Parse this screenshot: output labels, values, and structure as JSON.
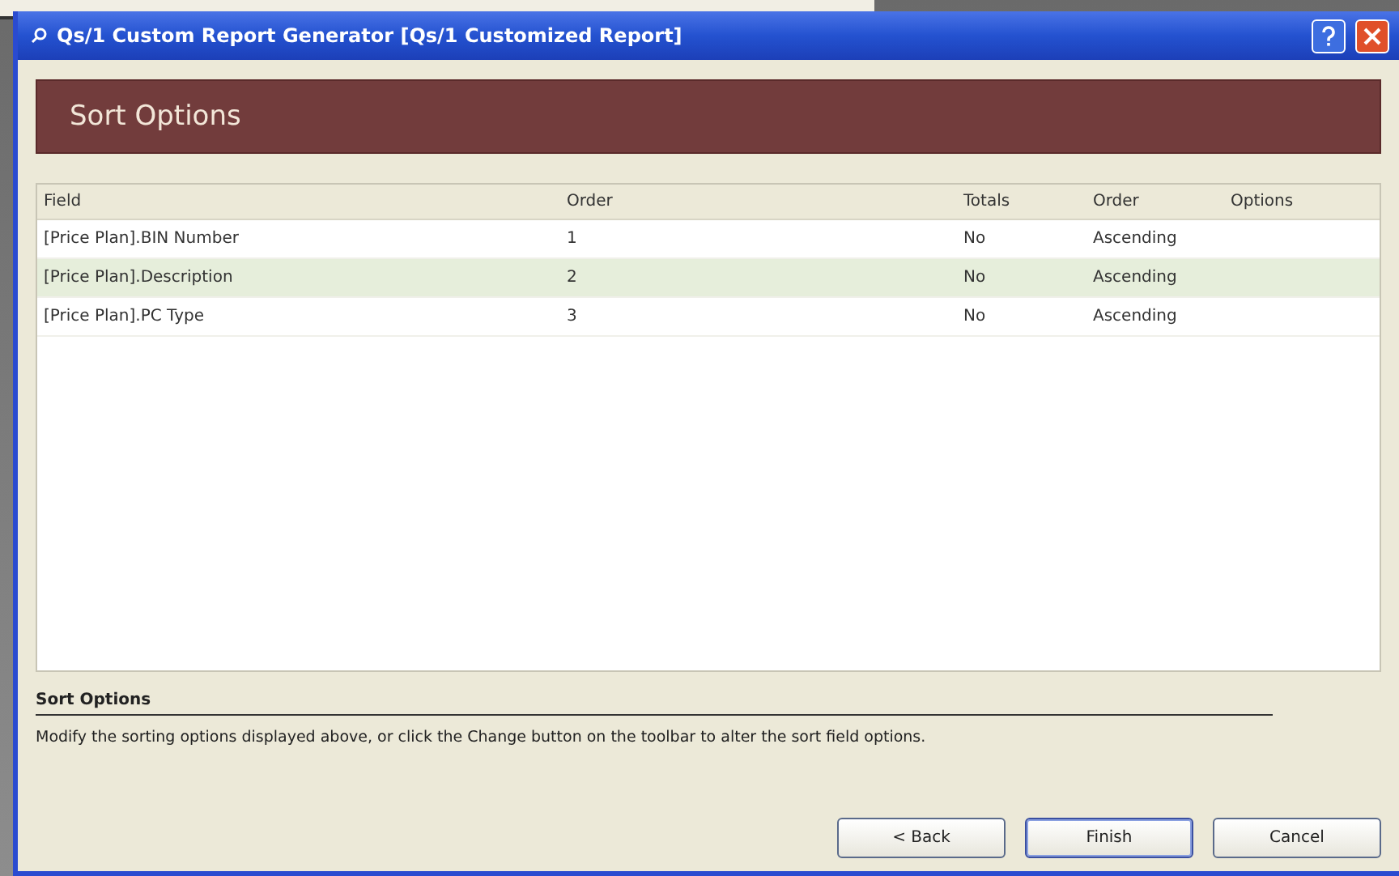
{
  "window": {
    "title": "Qs/1 Custom Report Generator [Qs/1 Customized Report]"
  },
  "banner": {
    "title": "Sort Options"
  },
  "table": {
    "columns": [
      "Field",
      "Order",
      "Totals",
      "Order",
      "Options"
    ],
    "rows": [
      {
        "cells": [
          "[Price Plan].BIN Number",
          "1",
          "No",
          "Ascending"
        ],
        "selected": false
      },
      {
        "cells": [
          "[Price Plan].Description",
          "2",
          "No",
          "Ascending"
        ],
        "selected": true
      },
      {
        "cells": [
          "[Price Plan].PC Type",
          "3",
          "No",
          "Ascending"
        ],
        "selected": false
      }
    ]
  },
  "help": {
    "title": "Sort Options",
    "text": "Modify the sorting options displayed above, or click the Change button on the toolbar to alter the sort field options."
  },
  "buttons": [
    {
      "label": "< Back",
      "default": false
    },
    {
      "label": "Finish",
      "default": true
    },
    {
      "label": "Cancel",
      "default": false
    }
  ]
}
